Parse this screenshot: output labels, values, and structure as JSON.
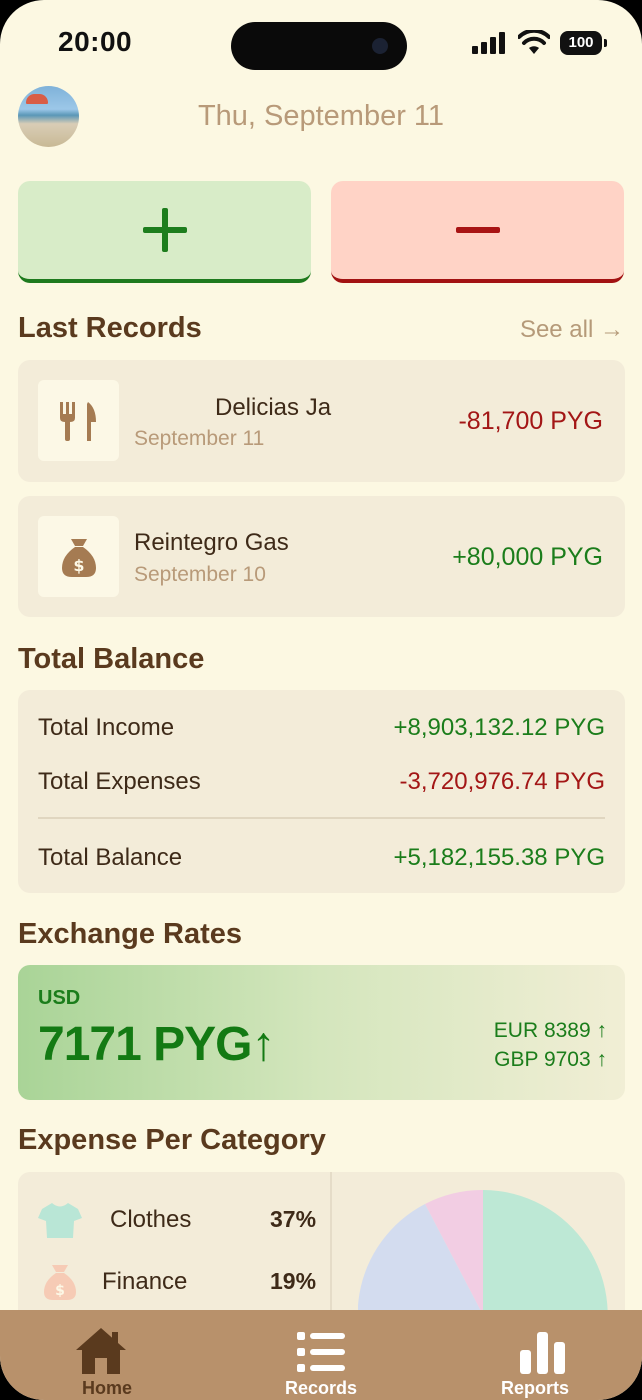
{
  "status_bar": {
    "time": "20:00",
    "battery": "100"
  },
  "header": {
    "date": "Thu, September 11"
  },
  "actions": {
    "add_symbol": "+",
    "subtract_symbol": "−"
  },
  "last_records": {
    "title": "Last Records",
    "see_all": "See all →",
    "items": [
      {
        "name": "Delicias Ja",
        "date": "September 11",
        "amount": "-81,700 PYG",
        "icon": "fork-knife-icon",
        "type": "expense"
      },
      {
        "name": "Reintegro Gas",
        "date": "September 10",
        "amount": "+80,000 PYG",
        "icon": "money-bag-icon",
        "type": "income"
      }
    ]
  },
  "total_balance": {
    "title": "Total Balance",
    "income_label": "Total Income",
    "income_value": "+8,903,132.12 PYG",
    "expenses_label": "Total Expenses",
    "expenses_value": "-3,720,976.74 PYG",
    "balance_label": "Total Balance",
    "balance_value": "+5,182,155.38 PYG"
  },
  "exchange_rates": {
    "title": "Exchange Rates",
    "base_currency": "USD",
    "main_rate": "7171 PYG↑",
    "others": [
      "EUR 8389 ↑",
      "GBP 9703 ↑"
    ]
  },
  "expense_per_category": {
    "title": "Expense Per Category",
    "items": [
      {
        "label": "Clothes",
        "percent": "37%",
        "icon": "shirt-icon",
        "color": "#b9e6d6"
      },
      {
        "label": "Finance",
        "percent": "19%",
        "icon": "money-bag-icon",
        "color": "#f6cbb5"
      }
    ],
    "pie_colors": [
      "#bde8d5",
      "#f2cde3",
      "#d3dcef"
    ]
  },
  "tab_bar": {
    "tabs": [
      {
        "label": "Home",
        "icon": "home-icon"
      },
      {
        "label": "Records",
        "icon": "list-icon"
      },
      {
        "label": "Reports",
        "icon": "bar-chart-icon"
      }
    ]
  },
  "colors": {
    "background": "#fcf8e2",
    "income": "#1b7d1b",
    "expense": "#a31616",
    "brown": "#5a3a1e",
    "tab_bar": "#b8916b"
  }
}
